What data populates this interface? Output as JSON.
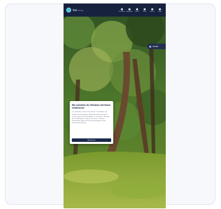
{
  "app": {
    "brand": "TUI",
    "brand_sub": "Verlag"
  },
  "nav": {
    "items": [
      {
        "label": "Reiseziele",
        "icon": "globe-icon"
      },
      {
        "label": "Angebote",
        "icon": "tag-icon"
      },
      {
        "label": "Hotels",
        "icon": "bed-icon"
      },
      {
        "label": "Flüge",
        "icon": "plane-icon"
      },
      {
        "label": "Service",
        "icon": "help-icon"
      },
      {
        "label": "Login",
        "icon": "user-icon"
      }
    ]
  },
  "side_tab": {
    "label": "Kontakt"
  },
  "dialog": {
    "title": "Wir möchten Ihr Erlebnis mit Ihnen verbessern",
    "body": "Wir verwenden Cookies und ähnliche Technologien, um Inhalte zu personalisieren, Werbung anzupassen und zu messen sowie das Nutzererlebnis zu verbessern. Mit einem Klick auf Akzeptieren stimmen Sie dem zu. Weitere Informationen finden Sie in den Einstellungen und der Datenschutzerklärung.",
    "button": "Akzeptieren"
  },
  "colors": {
    "nav_bg": "#17223f",
    "button_bg": "#1c2a4d",
    "accent": "#33c2d6"
  }
}
